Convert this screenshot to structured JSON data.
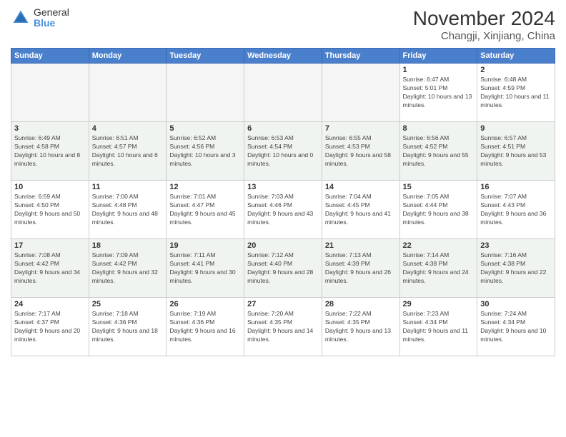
{
  "logo": {
    "general": "General",
    "blue": "Blue"
  },
  "title": "November 2024",
  "location": "Changji, Xinjiang, China",
  "days_of_week": [
    "Sunday",
    "Monday",
    "Tuesday",
    "Wednesday",
    "Thursday",
    "Friday",
    "Saturday"
  ],
  "weeks": [
    [
      {
        "day": "",
        "sunrise": "",
        "sunset": "",
        "daylight": ""
      },
      {
        "day": "",
        "sunrise": "",
        "sunset": "",
        "daylight": ""
      },
      {
        "day": "",
        "sunrise": "",
        "sunset": "",
        "daylight": ""
      },
      {
        "day": "",
        "sunrise": "",
        "sunset": "",
        "daylight": ""
      },
      {
        "day": "",
        "sunrise": "",
        "sunset": "",
        "daylight": ""
      },
      {
        "day": "1",
        "sunrise": "Sunrise: 6:47 AM",
        "sunset": "Sunset: 5:01 PM",
        "daylight": "Daylight: 10 hours and 13 minutes."
      },
      {
        "day": "2",
        "sunrise": "Sunrise: 6:48 AM",
        "sunset": "Sunset: 4:59 PM",
        "daylight": "Daylight: 10 hours and 11 minutes."
      }
    ],
    [
      {
        "day": "3",
        "sunrise": "Sunrise: 6:49 AM",
        "sunset": "Sunset: 4:58 PM",
        "daylight": "Daylight: 10 hours and 8 minutes."
      },
      {
        "day": "4",
        "sunrise": "Sunrise: 6:51 AM",
        "sunset": "Sunset: 4:57 PM",
        "daylight": "Daylight: 10 hours and 6 minutes."
      },
      {
        "day": "5",
        "sunrise": "Sunrise: 6:52 AM",
        "sunset": "Sunset: 4:56 PM",
        "daylight": "Daylight: 10 hours and 3 minutes."
      },
      {
        "day": "6",
        "sunrise": "Sunrise: 6:53 AM",
        "sunset": "Sunset: 4:54 PM",
        "daylight": "Daylight: 10 hours and 0 minutes."
      },
      {
        "day": "7",
        "sunrise": "Sunrise: 6:55 AM",
        "sunset": "Sunset: 4:53 PM",
        "daylight": "Daylight: 9 hours and 58 minutes."
      },
      {
        "day": "8",
        "sunrise": "Sunrise: 6:56 AM",
        "sunset": "Sunset: 4:52 PM",
        "daylight": "Daylight: 9 hours and 55 minutes."
      },
      {
        "day": "9",
        "sunrise": "Sunrise: 6:57 AM",
        "sunset": "Sunset: 4:51 PM",
        "daylight": "Daylight: 9 hours and 53 minutes."
      }
    ],
    [
      {
        "day": "10",
        "sunrise": "Sunrise: 6:59 AM",
        "sunset": "Sunset: 4:50 PM",
        "daylight": "Daylight: 9 hours and 50 minutes."
      },
      {
        "day": "11",
        "sunrise": "Sunrise: 7:00 AM",
        "sunset": "Sunset: 4:48 PM",
        "daylight": "Daylight: 9 hours and 48 minutes."
      },
      {
        "day": "12",
        "sunrise": "Sunrise: 7:01 AM",
        "sunset": "Sunset: 4:47 PM",
        "daylight": "Daylight: 9 hours and 45 minutes."
      },
      {
        "day": "13",
        "sunrise": "Sunrise: 7:03 AM",
        "sunset": "Sunset: 4:46 PM",
        "daylight": "Daylight: 9 hours and 43 minutes."
      },
      {
        "day": "14",
        "sunrise": "Sunrise: 7:04 AM",
        "sunset": "Sunset: 4:45 PM",
        "daylight": "Daylight: 9 hours and 41 minutes."
      },
      {
        "day": "15",
        "sunrise": "Sunrise: 7:05 AM",
        "sunset": "Sunset: 4:44 PM",
        "daylight": "Daylight: 9 hours and 38 minutes."
      },
      {
        "day": "16",
        "sunrise": "Sunrise: 7:07 AM",
        "sunset": "Sunset: 4:43 PM",
        "daylight": "Daylight: 9 hours and 36 minutes."
      }
    ],
    [
      {
        "day": "17",
        "sunrise": "Sunrise: 7:08 AM",
        "sunset": "Sunset: 4:42 PM",
        "daylight": "Daylight: 9 hours and 34 minutes."
      },
      {
        "day": "18",
        "sunrise": "Sunrise: 7:09 AM",
        "sunset": "Sunset: 4:42 PM",
        "daylight": "Daylight: 9 hours and 32 minutes."
      },
      {
        "day": "19",
        "sunrise": "Sunrise: 7:11 AM",
        "sunset": "Sunset: 4:41 PM",
        "daylight": "Daylight: 9 hours and 30 minutes."
      },
      {
        "day": "20",
        "sunrise": "Sunrise: 7:12 AM",
        "sunset": "Sunset: 4:40 PM",
        "daylight": "Daylight: 9 hours and 28 minutes."
      },
      {
        "day": "21",
        "sunrise": "Sunrise: 7:13 AM",
        "sunset": "Sunset: 4:39 PM",
        "daylight": "Daylight: 9 hours and 26 minutes."
      },
      {
        "day": "22",
        "sunrise": "Sunrise: 7:14 AM",
        "sunset": "Sunset: 4:38 PM",
        "daylight": "Daylight: 9 hours and 24 minutes."
      },
      {
        "day": "23",
        "sunrise": "Sunrise: 7:16 AM",
        "sunset": "Sunset: 4:38 PM",
        "daylight": "Daylight: 9 hours and 22 minutes."
      }
    ],
    [
      {
        "day": "24",
        "sunrise": "Sunrise: 7:17 AM",
        "sunset": "Sunset: 4:37 PM",
        "daylight": "Daylight: 9 hours and 20 minutes."
      },
      {
        "day": "25",
        "sunrise": "Sunrise: 7:18 AM",
        "sunset": "Sunset: 4:36 PM",
        "daylight": "Daylight: 9 hours and 18 minutes."
      },
      {
        "day": "26",
        "sunrise": "Sunrise: 7:19 AM",
        "sunset": "Sunset: 4:36 PM",
        "daylight": "Daylight: 9 hours and 16 minutes."
      },
      {
        "day": "27",
        "sunrise": "Sunrise: 7:20 AM",
        "sunset": "Sunset: 4:35 PM",
        "daylight": "Daylight: 9 hours and 14 minutes."
      },
      {
        "day": "28",
        "sunrise": "Sunrise: 7:22 AM",
        "sunset": "Sunset: 4:35 PM",
        "daylight": "Daylight: 9 hours and 13 minutes."
      },
      {
        "day": "29",
        "sunrise": "Sunrise: 7:23 AM",
        "sunset": "Sunset: 4:34 PM",
        "daylight": "Daylight: 9 hours and 11 minutes."
      },
      {
        "day": "30",
        "sunrise": "Sunrise: 7:24 AM",
        "sunset": "Sunset: 4:34 PM",
        "daylight": "Daylight: 9 hours and 10 minutes."
      }
    ]
  ]
}
